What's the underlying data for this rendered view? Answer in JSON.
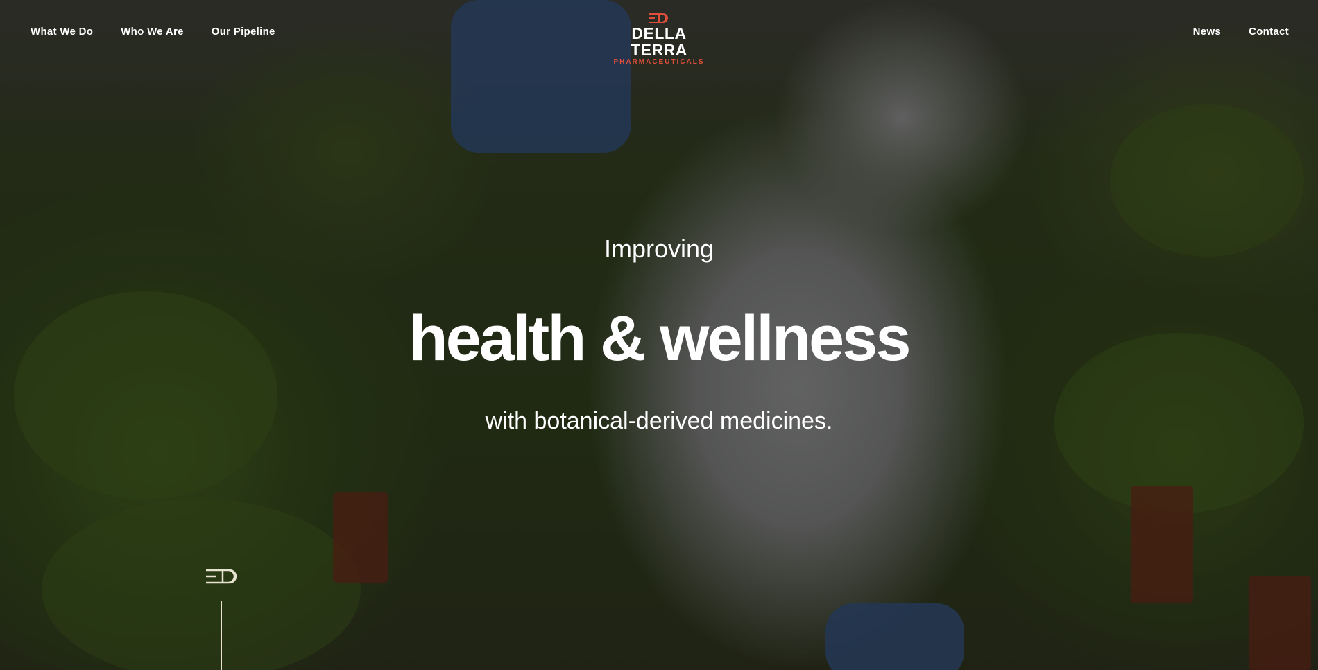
{
  "nav": {
    "left_links": [
      "What We Do",
      "Who We Are",
      "Our Pipeline"
    ],
    "right_links": [
      "News",
      "Contact"
    ]
  },
  "logo": {
    "name": "DELLA TERRA",
    "subtitle": "PHARMACEUTICALS",
    "icon": "della-terra-mark-icon",
    "brand_color": "#e04e3c"
  },
  "hero": {
    "line1": "Improving",
    "headline": "health & wellness",
    "line3": "with botanical-derived medicines."
  },
  "scroll_indicator": {
    "icon": "della-terra-mark-icon",
    "color": "#e8e2d0"
  }
}
